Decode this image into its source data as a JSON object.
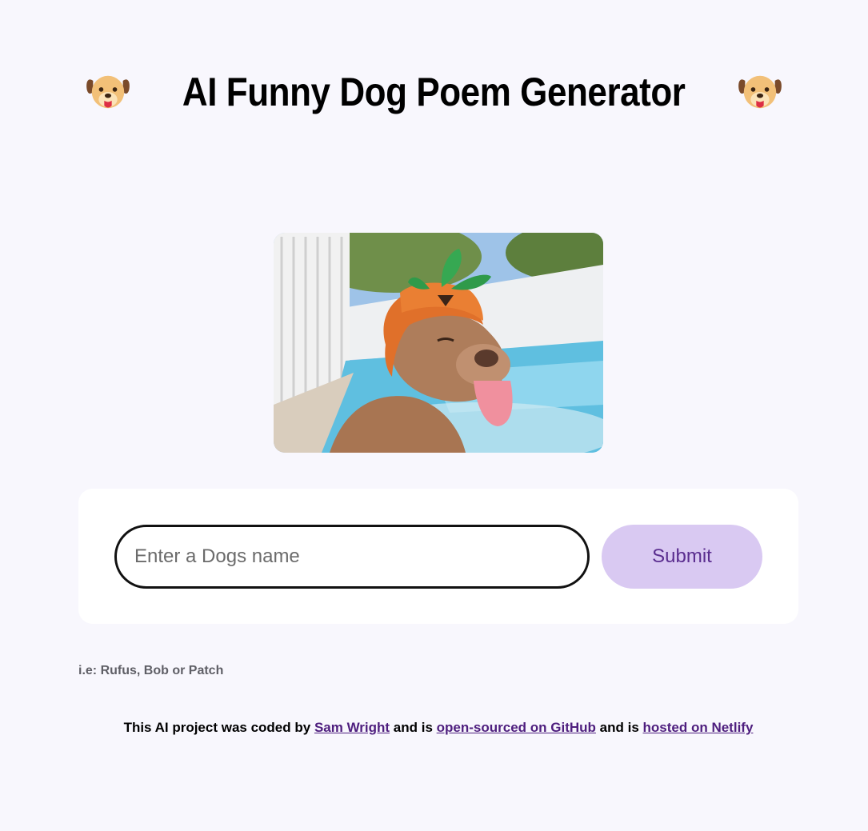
{
  "header": {
    "title": "AI Funny Dog Poem Generator",
    "left_icon": "dog-face-icon",
    "right_icon": "dog-face-icon"
  },
  "photo": {
    "icon": "dog-photo"
  },
  "form": {
    "input_placeholder": "Enter a Dogs name",
    "input_value": "",
    "submit_label": "Submit"
  },
  "hint": "i.e: Rufus, Bob or Patch",
  "footer": {
    "text_1": "This AI project was coded by ",
    "author_link": "Sam Wright",
    "text_2": " and is ",
    "github_link": "open-sourced on GitHub",
    "text_3": " and is ",
    "netlify_link": "hosted on Netlify"
  },
  "colors": {
    "background": "#f8f7fd",
    "button_bg": "#d9c9f2",
    "button_text": "#5a2d8f",
    "link": "#4e1e7e"
  }
}
